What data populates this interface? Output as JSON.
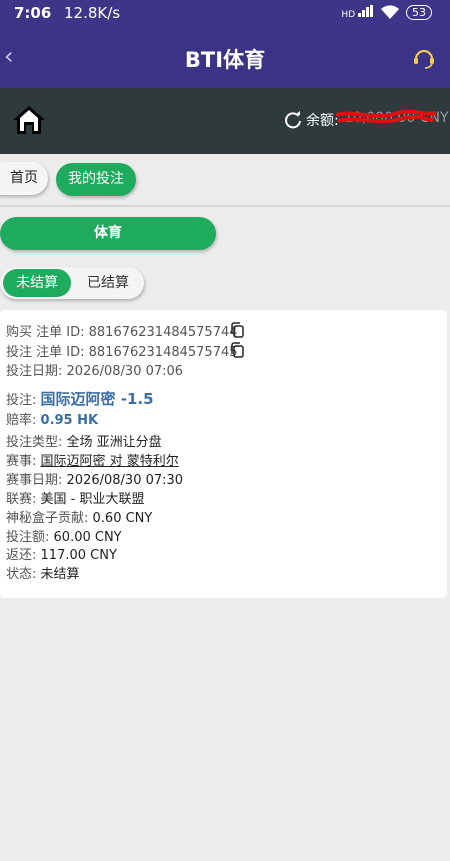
{
  "status_bar": {
    "time": "7:06",
    "speed": "12.8K/s",
    "signal": "HD",
    "battery": "53"
  },
  "header": {
    "title": "BTI体育"
  },
  "balance": {
    "label": "余额:",
    "amount": "10,000.00 CNY"
  },
  "nav": {
    "home": "首页",
    "my_bets": "我的投注"
  },
  "category": {
    "sport": "体育"
  },
  "toggle": {
    "unsettled": "未结算",
    "settled": "已结算"
  },
  "bet": {
    "purchase_id_label": "购买 注单 ID:",
    "purchase_id": "881676231484575744",
    "bet_id_label": "投注 注单 ID:",
    "bet_id": "881676231484575745",
    "date_label": "投注日期:",
    "date": "2026/08/30 07:06",
    "pick_label": "投注:",
    "pick": "国际迈阿密 -1.5",
    "odds_label": "赔率:",
    "odds": "0.95 HK",
    "type_label": "投注类型:",
    "type": "全场 亚洲让分盘",
    "match_label": "赛事:",
    "match": "国际迈阿密 对 蒙特利尔",
    "match_date_label": "赛事日期:",
    "match_date": "2026/08/30 07:30",
    "league_label": "联赛:",
    "league": "美国 - 职业大联盟",
    "mystery_label": "神秘盒子贡献:",
    "mystery": "0.60 CNY",
    "stake_label": "投注额:",
    "stake": "60.00 CNY",
    "return_label": "返还:",
    "return": "117.00 CNY",
    "status_label": "状态:",
    "status": "未结算"
  },
  "colors": {
    "accent": "#1fab5d",
    "header": "#3a3386",
    "balance_bar": "#2f3a3d",
    "link": "#3a6fa8"
  }
}
